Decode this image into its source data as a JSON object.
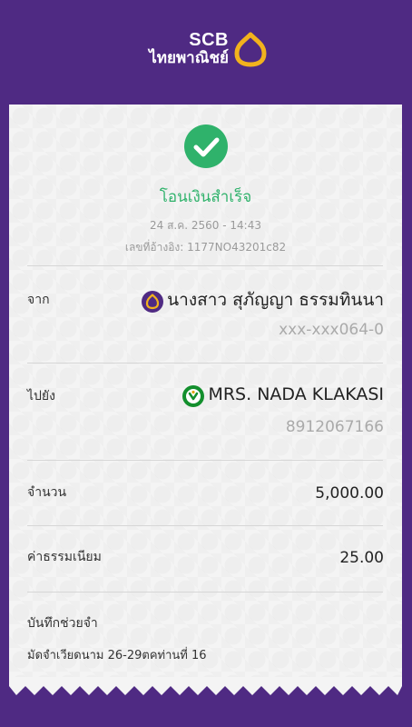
{
  "header": {
    "bank_name_en": "SCB",
    "bank_name_th": "ไทยพาณิชย์"
  },
  "slip": {
    "status": "โอนเงินสำเร็จ",
    "datetime": "24 ส.ค. 2560 - 14:43",
    "reference": "เลขที่อ้างอิง: 1177NO43201c82",
    "from": {
      "label": "จาก",
      "name": "นางสาว สุภัญญา ธรรมทินนา",
      "account": "xxx-xxx064-0",
      "bank_icon": "scb-icon"
    },
    "to": {
      "label": "ไปยัง",
      "name": "MRS. NADA KLAKASI",
      "account": "8912067166",
      "bank_icon": "kbank-icon"
    },
    "amount": {
      "label": "จำนวน",
      "value": "5,000.00"
    },
    "fee": {
      "label": "ค่าธรรมเนียม",
      "value": "25.00"
    },
    "memo": {
      "label": "บันทึกช่วยจำ",
      "value": "มัดจำเวียดนาม 26-29ตคท่านที่ 16"
    }
  },
  "colors": {
    "brand_purple": "#4f2a83",
    "success_green": "#2fb26b",
    "scb_gold": "#f2b21d"
  }
}
